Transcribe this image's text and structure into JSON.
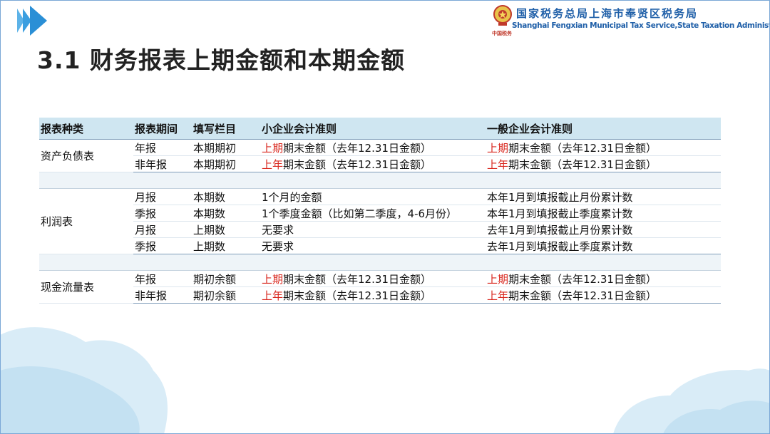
{
  "header": {
    "org_name_cn": "国家税务总局上海市奉贤区税务局",
    "org_name_en": "Shanghai Fengxian Municipal Tax Service,State Taxation Administration",
    "seal_text": "中国税务"
  },
  "title": "3.1 财务报表上期金额和本期金额",
  "table": {
    "headers": [
      "报表种类",
      "报表期间",
      "填写栏目",
      "小企业会计准则",
      "一般企业会计准则"
    ],
    "sections": [
      {
        "category": "资产负债表",
        "rows": [
          {
            "period": "年报",
            "field": "本期期初",
            "small_hl": "上期",
            "small_rest": "期末金额（去年12.31日金额）",
            "general_hl": "上期",
            "general_rest": "期末金额（去年12.31日金额）"
          },
          {
            "period": "非年报",
            "field": "本期期初",
            "small_hl": "上年",
            "small_rest": "期末金额（去年12.31日金额）",
            "general_hl": "上年",
            "general_rest": "期末金额（去年12.31日金额）"
          }
        ]
      },
      {
        "category": "利润表",
        "rows": [
          {
            "period": "月报",
            "field": "本期数",
            "small_hl": "",
            "small_rest": "1个月的金额",
            "general_hl": "",
            "general_rest": "本年1月到填报截止月份累计数"
          },
          {
            "period": "季报",
            "field": "本期数",
            "small_hl": "",
            "small_rest": "1个季度金额（比如第二季度，4-6月份）",
            "general_hl": "",
            "general_rest": "本年1月到填报截止季度累计数"
          },
          {
            "period": "月报",
            "field": "上期数",
            "small_hl": "",
            "small_rest": "无要求",
            "general_hl": "",
            "general_rest": "去年1月到填报截止月份累计数"
          },
          {
            "period": "季报",
            "field": "上期数",
            "small_hl": "",
            "small_rest": "无要求",
            "general_hl": "",
            "general_rest": "去年1月到填报截止季度累计数"
          }
        ]
      },
      {
        "category": "现金流量表",
        "rows": [
          {
            "period": "年报",
            "field": "期初余额",
            "small_hl": "上期",
            "small_rest": "期末金额（去年12.31日金额）",
            "general_hl": "上期",
            "general_rest": "期末金额（去年12.31日金额）"
          },
          {
            "period": "非年报",
            "field": "期初余额",
            "small_hl": "上年",
            "small_rest": "期末金额（去年12.31日金额）",
            "general_hl": "上年",
            "general_rest": "期末金额（去年12.31日金额）"
          }
        ]
      }
    ]
  },
  "colors": {
    "accent_blue": "#1f5fa8",
    "header_fill": "#cfe6f1",
    "highlight_red": "#d9281f",
    "arrow_blue": "#2a8fd6"
  },
  "icons": [
    "play-arrows-icon",
    "tax-emblem-icon"
  ]
}
